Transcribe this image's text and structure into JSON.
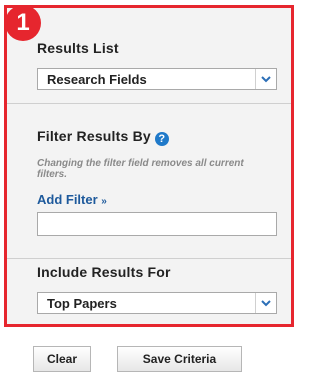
{
  "step_badge": "1",
  "results_list": {
    "heading": "Results List",
    "selected": "Research Fields",
    "arrow_icon": "chevron-down-icon"
  },
  "filter": {
    "heading": "Filter Results By",
    "help_glyph": "?",
    "note": "Changing the filter field removes all current filters.",
    "add_filter_label": "Add Filter",
    "add_filter_chevron": "»",
    "input_value": ""
  },
  "include": {
    "heading": "Include Results For",
    "selected": "Top Papers",
    "arrow_icon": "chevron-down-icon"
  },
  "buttons": {
    "clear": "Clear",
    "save": "Save Criteria"
  },
  "colors": {
    "highlight": "#e6262e",
    "link": "#1e5a9c",
    "help": "#1f79c9",
    "panel_bg": "#f3f3f3"
  }
}
